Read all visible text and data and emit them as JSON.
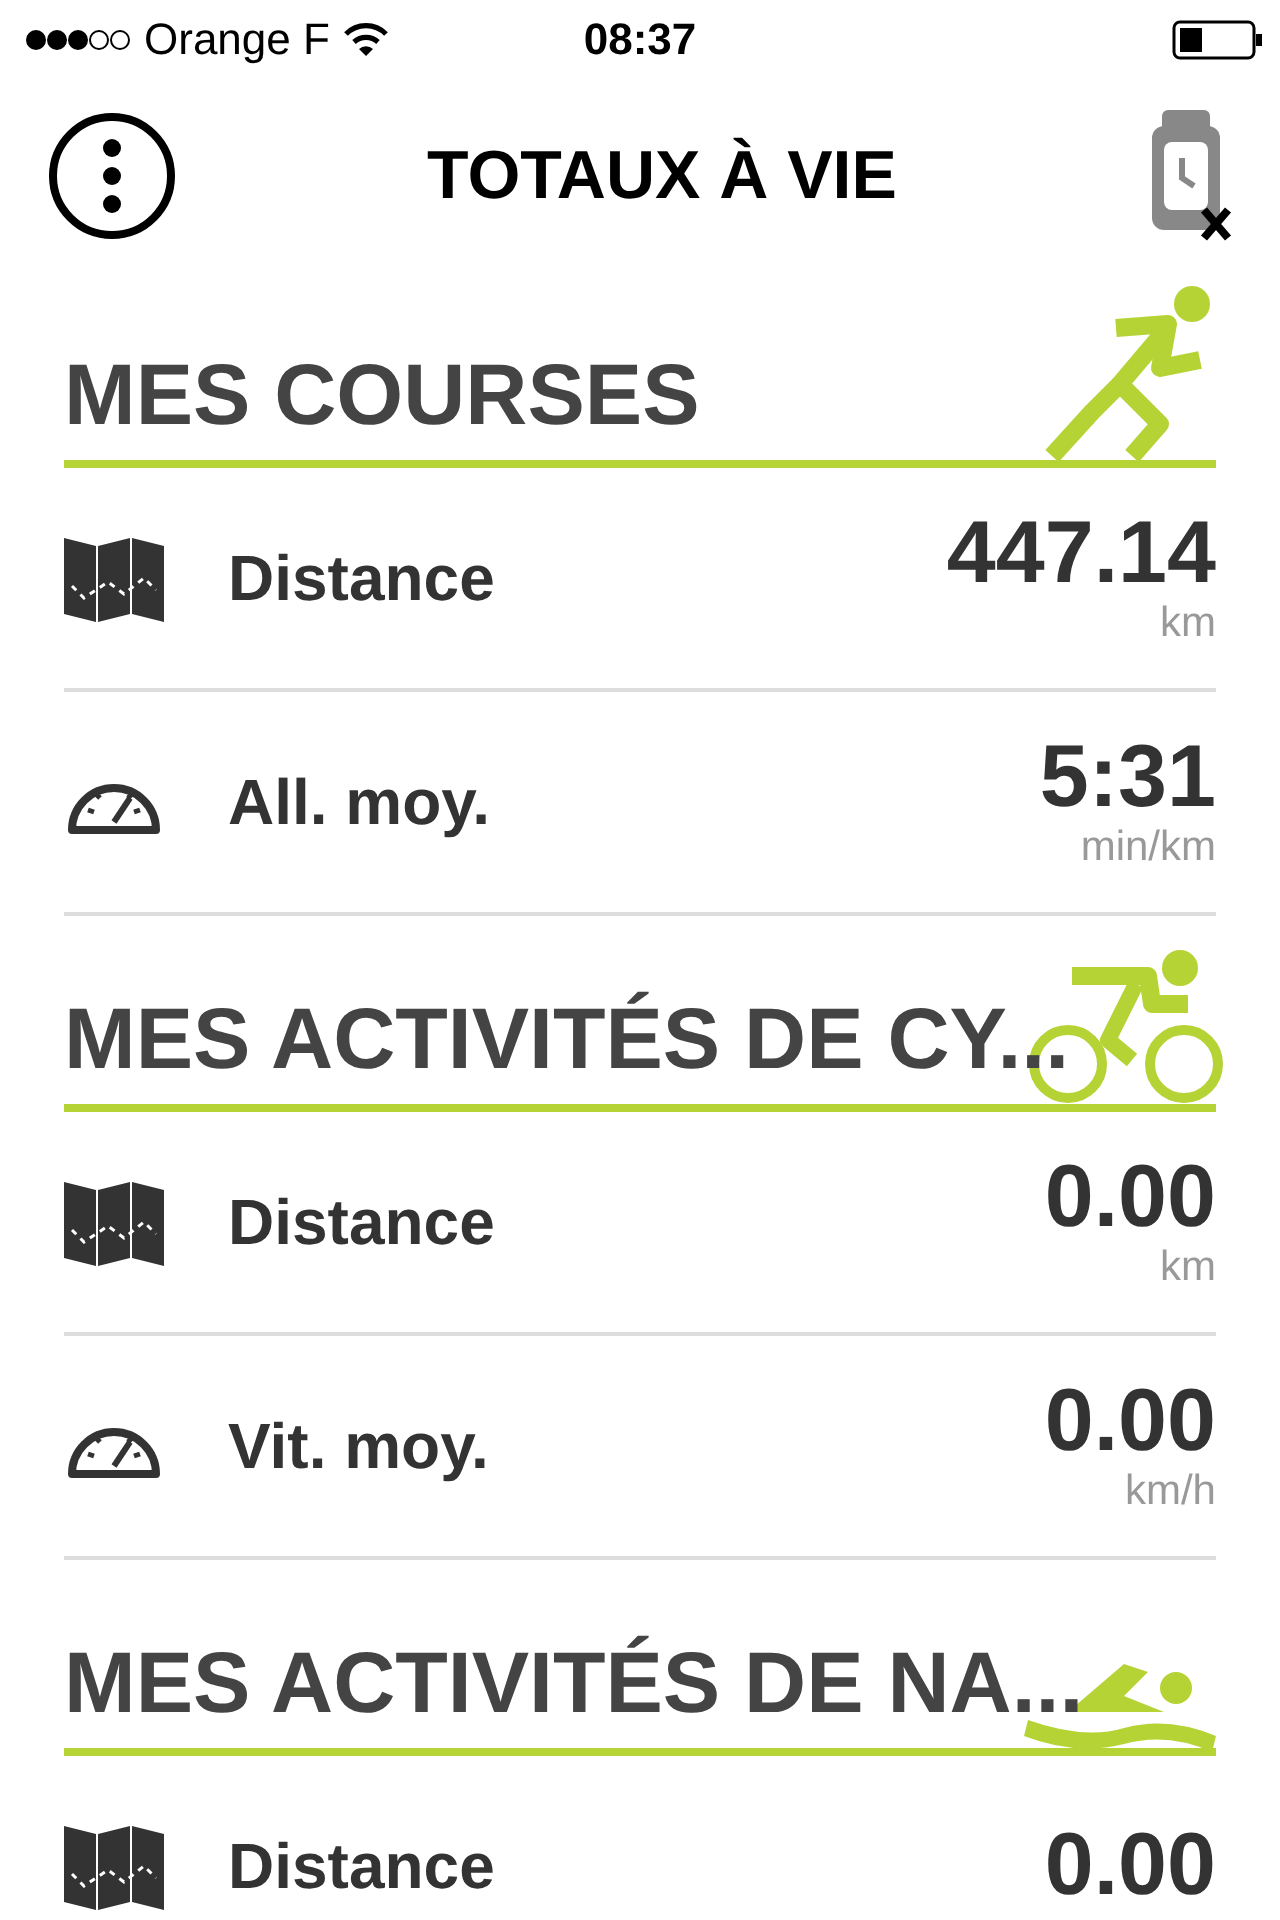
{
  "status_bar": {
    "carrier": "Orange F",
    "time": "08:37"
  },
  "header": {
    "title": "TOTAUX À VIE"
  },
  "sections": [
    {
      "title": "MES COURSES",
      "kind": "run",
      "rows": [
        {
          "kind": "distance",
          "label": "Distance",
          "value": "447.14",
          "unit": "km"
        },
        {
          "kind": "speed",
          "label": "All. moy.",
          "value": "5:31",
          "unit": "min/km"
        }
      ]
    },
    {
      "title": "MES ACTIVITÉS DE CY...",
      "kind": "bike",
      "rows": [
        {
          "kind": "distance",
          "label": "Distance",
          "value": "0.00",
          "unit": "km"
        },
        {
          "kind": "speed",
          "label": "Vit. moy.",
          "value": "0.00",
          "unit": "km/h"
        }
      ]
    },
    {
      "title": "MES ACTIVITÉS DE NA...",
      "kind": "swim",
      "rows": [
        {
          "kind": "distance",
          "label": "Distance",
          "value": "0.00"
        }
      ]
    }
  ]
}
